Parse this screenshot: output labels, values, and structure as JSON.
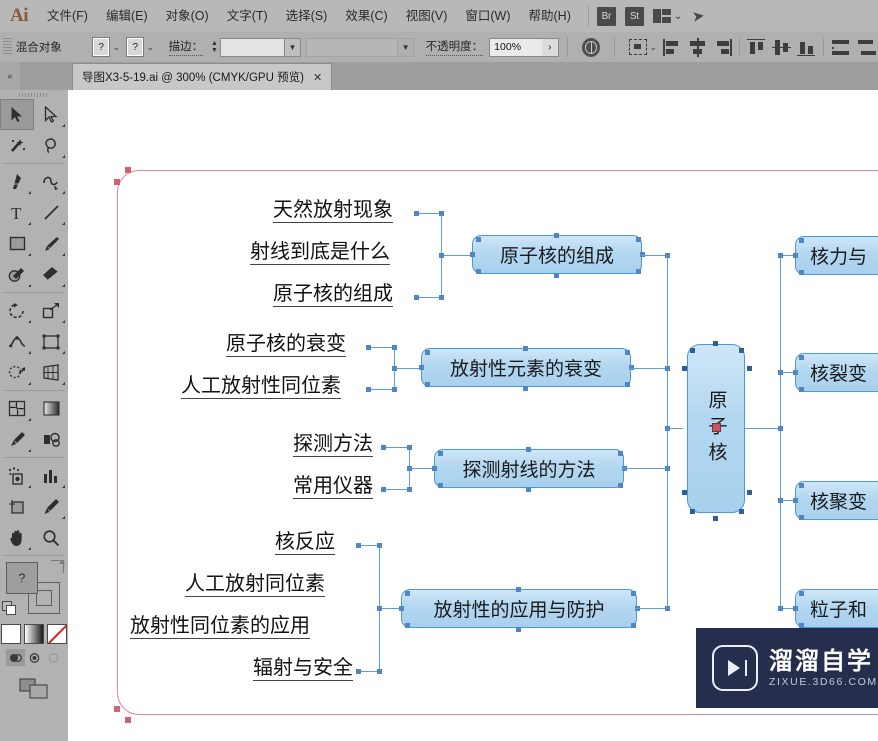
{
  "app": {
    "name": "Ai",
    "menu": [
      "文件(F)",
      "编辑(E)",
      "对象(O)",
      "文字(T)",
      "选择(S)",
      "效果(C)",
      "视图(V)",
      "窗口(W)",
      "帮助(H)"
    ],
    "quick_badges": [
      "Br",
      "St"
    ],
    "workspace_chevron": "⌄"
  },
  "control_bar": {
    "object_label": "混合对象",
    "swatch_a": "?",
    "swatch_b": "?",
    "stroke_label": "描边：",
    "stroke_weight": "",
    "stroke_profile": "",
    "opacity_label": "不透明度：",
    "opacity_value": "100%",
    "opacity_more": "›",
    "chevron": "⌄"
  },
  "tab_bar": {
    "collapse_icon": "«",
    "document_title": "导图X3-5-19.ai @ 300% (CMYK/GPU 预览)",
    "close": "✕"
  },
  "tools": {
    "rows": [
      [
        {
          "name": "selection-tool",
          "sel": true
        },
        {
          "name": "direct-selection-tool",
          "sel": false
        }
      ],
      [
        {
          "name": "magic-wand-tool",
          "sel": false
        },
        {
          "name": "lasso-tool",
          "sel": false
        }
      ],
      [
        {
          "name": "pen-tool",
          "sel": false
        },
        {
          "name": "curvature-tool",
          "sel": false
        }
      ],
      [
        {
          "name": "type-tool",
          "sel": false
        },
        {
          "name": "line-segment-tool",
          "sel": false
        }
      ],
      [
        {
          "name": "rectangle-tool",
          "sel": false
        },
        {
          "name": "paintbrush-tool",
          "sel": false
        }
      ],
      [
        {
          "name": "shaper-tool",
          "sel": false
        },
        {
          "name": "eraser-tool",
          "sel": false
        }
      ],
      [
        {
          "name": "rotate-tool",
          "sel": false
        },
        {
          "name": "scale-tool",
          "sel": false
        }
      ],
      [
        {
          "name": "width-tool",
          "sel": false
        },
        {
          "name": "free-transform-tool",
          "sel": false
        }
      ],
      [
        {
          "name": "shape-builder-tool",
          "sel": false
        },
        {
          "name": "perspective-grid-tool",
          "sel": false
        }
      ],
      [
        {
          "name": "mesh-tool",
          "sel": false
        },
        {
          "name": "gradient-tool",
          "sel": false
        }
      ],
      [
        {
          "name": "eyedropper-tool",
          "sel": false
        },
        {
          "name": "blend-tool",
          "sel": false
        }
      ],
      [
        {
          "name": "symbol-sprayer-tool",
          "sel": false
        },
        {
          "name": "column-graph-tool",
          "sel": false
        }
      ],
      [
        {
          "name": "artboard-tool",
          "sel": false
        },
        {
          "name": "slice-tool",
          "sel": false
        }
      ],
      [
        {
          "name": "hand-tool",
          "sel": false
        },
        {
          "name": "zoom-tool",
          "sel": false
        }
      ]
    ],
    "fill_swatch_label": "?",
    "color_boxes": [
      "color-swatch-white",
      "gradient-swatch",
      "none-swatch"
    ],
    "draw_modes": [
      "draw-normal",
      "draw-behind",
      "draw-inside"
    ],
    "screen_mode": "change-screen-mode"
  },
  "mindmap": {
    "center_node": "原子核",
    "branches": [
      {
        "node": "原子核的组成",
        "leaves": [
          "天然放射现象",
          "射线到底是什么",
          "原子核的组成"
        ]
      },
      {
        "node": "放射性元素的衰变",
        "leaves": [
          "原子核的衰变",
          "人工放射性同位素"
        ]
      },
      {
        "node": "探测射线的方法",
        "leaves": [
          "探测方法",
          "常用仪器"
        ]
      },
      {
        "node": "放射性的应用与防护",
        "leaves": [
          "核反应",
          "人工放射同位素",
          "放射性同位素的应用",
          "辐射与安全"
        ]
      }
    ],
    "right_nodes": [
      "核力与",
      "核裂变",
      "核聚变",
      "粒子和"
    ]
  },
  "watermark": {
    "title": "溜溜自学",
    "url": "ZIXUE.3D66.COM"
  },
  "colors": {
    "node_fill": "#b3d7f0",
    "node_border": "#4a9ad4",
    "connector": "#5b9fd6",
    "artboard_border": "#d88b93",
    "chrome": "#b8b8b8",
    "watermark_bg": "#252f4d"
  }
}
